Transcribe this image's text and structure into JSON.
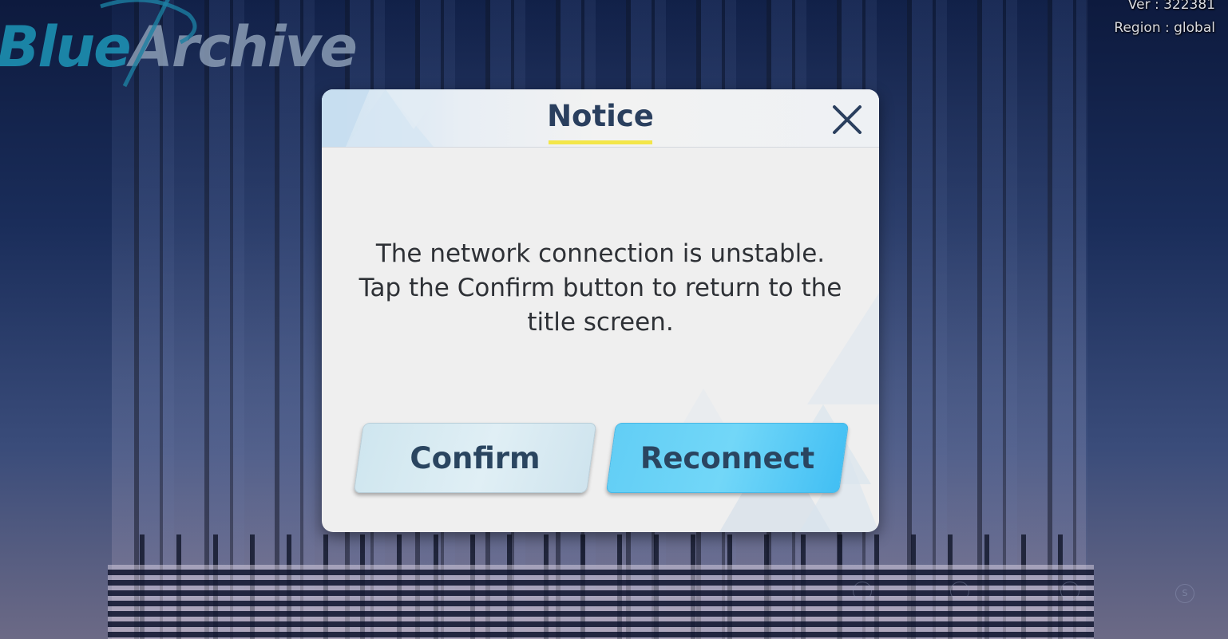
{
  "app": {
    "logo_part1": "Blue",
    "logo_part2": "Archive"
  },
  "version": {
    "ver_text": "Ver : 322381",
    "region_text": "Region : global"
  },
  "dialog": {
    "title": "Notice",
    "message_line1": "The network connection is unstable.",
    "message_line2": "Tap the Confirm button to return to the",
    "message_line3": "title screen.",
    "confirm_label": "Confirm",
    "reconnect_label": "Reconnect"
  },
  "background": {
    "glyph_labels": [
      "S"
    ]
  },
  "colors": {
    "title": "#2a3f5e",
    "title_underline": "#f3e64a",
    "reconnect_button": "#62cef5",
    "confirm_button": "#d7ebf2"
  },
  "icons": {
    "close": "close-icon"
  }
}
